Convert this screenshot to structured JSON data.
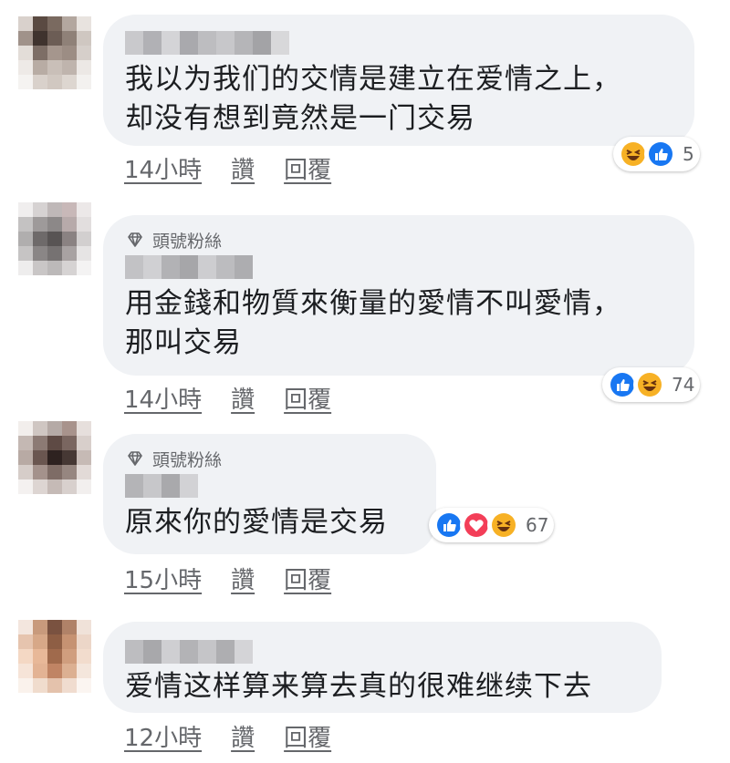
{
  "badge_label": "頭號粉絲",
  "actions": {
    "like": "讚",
    "reply": "回覆"
  },
  "comments": [
    {
      "text": "我以为我们的交情是建立在爱情之上，\n却没有想到竟然是一门交易",
      "time": "14小時",
      "reactions": [
        "haha-icon",
        "like-icon"
      ],
      "count": "5"
    },
    {
      "badge": true,
      "text": "用金錢和物質來衡量的愛情不叫愛情，\n那叫交易",
      "time": "14小時",
      "reactions": [
        "like-icon",
        "haha-icon"
      ],
      "count": "74"
    },
    {
      "badge": true,
      "text": "原來你的愛情是交易",
      "time": "15小時",
      "reactions": [
        "like-icon",
        "love-icon",
        "haha-icon"
      ],
      "count": "67"
    },
    {
      "text": "爱情这样算来算去真的很难继续下去",
      "time": "12小時",
      "reactions": [],
      "count": ""
    }
  ],
  "colors": {
    "bubble": "#f0f2f5",
    "like": "#1877f2",
    "love": "#f33e58",
    "haha": "#f7b125",
    "meta": "#65676b"
  }
}
